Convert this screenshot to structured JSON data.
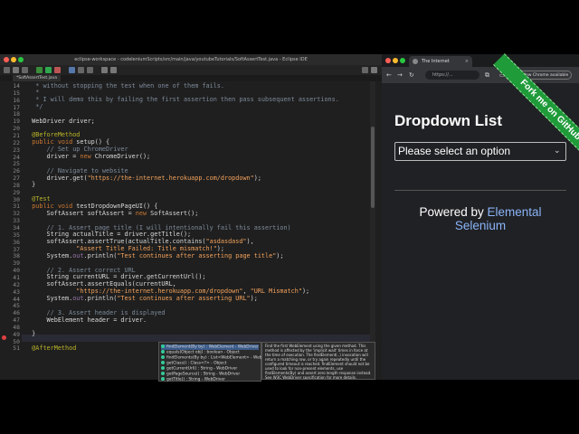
{
  "eclipse": {
    "window_title": "eclipse-workspace - codeleniumScripts/src/main/java/youtubeTutorials/SoftAssertTest.java - Eclipse IDE",
    "tab_label": "*SoftAssertTest.java",
    "lines": [
      {
        "no": "14",
        "text": "   * without stopping the test when one of them fails."
      },
      {
        "no": "15",
        "text": "   *"
      },
      {
        "no": "16",
        "text": "   * I will demo this by failing the first assertion then pass subsequent assertions."
      },
      {
        "no": "17",
        "text": "   */"
      },
      {
        "no": "18",
        "text": ""
      },
      {
        "no": "19",
        "text": "  WebDriver driver;"
      },
      {
        "no": "20",
        "text": ""
      },
      {
        "no": "21",
        "text": "  @BeforeMethod"
      },
      {
        "no": "22",
        "text": "  public void setup() {"
      },
      {
        "no": "23",
        "text": "      // Set up ChromeDriver"
      },
      {
        "no": "24",
        "text": "      driver = new ChromeDriver();"
      },
      {
        "no": "25",
        "text": ""
      },
      {
        "no": "26",
        "text": "      // Navigate to website"
      },
      {
        "no": "27",
        "text": "      driver.get(\"https://the-internet.herokuapp.com/dropdown\");"
      },
      {
        "no": "28",
        "text": "  }"
      },
      {
        "no": "29",
        "text": ""
      },
      {
        "no": "30",
        "text": "  @Test"
      },
      {
        "no": "31",
        "text": "  public void testDropdownPageUI() {"
      },
      {
        "no": "32",
        "text": "      SoftAssert softAssert = new SoftAssert();"
      },
      {
        "no": "33",
        "text": ""
      },
      {
        "no": "34",
        "text": "      // 1. Assert page title (I will intentionally fail this assertion)"
      },
      {
        "no": "35",
        "text": "      String actualTitle = driver.getTitle();"
      },
      {
        "no": "36",
        "text": "      softAssert.assertTrue(actualTitle.contains(\"asdasdasd\"),"
      },
      {
        "no": "37",
        "text": "              \"Assert Title Failed: Title mismatch!\");"
      },
      {
        "no": "38",
        "text": "      System.out.println(\"Test continues after asserting page title\");"
      },
      {
        "no": "39",
        "text": ""
      },
      {
        "no": "40",
        "text": "      // 2. Assert correct URL"
      },
      {
        "no": "41",
        "text": "      String currentURL = driver.getCurrentUrl();"
      },
      {
        "no": "42",
        "text": "      softAssert.assertEquals(currentURL,"
      },
      {
        "no": "43",
        "text": "              \"https://the-internet.herokuapp.com/dropdown\", \"URL Mismatch\");"
      },
      {
        "no": "44",
        "text": "      System.out.println(\"Test continues after asserting URL\");"
      },
      {
        "no": "45",
        "text": ""
      },
      {
        "no": "46",
        "text": "      // 3. Assert header is displayed"
      },
      {
        "no": "47",
        "text": "      WebElement header = driver."
      },
      {
        "no": "48",
        "text": ""
      },
      {
        "no": "49",
        "text": "  }"
      },
      {
        "no": "50",
        "text": ""
      },
      {
        "no": "51",
        "text": "  @AfterMethod"
      }
    ],
    "autocomplete": {
      "items": [
        "findElement(By by) : WebElement - WebDriver",
        "equals(Object obj) : boolean - Object",
        "findElements(By by) : List<WebElement> - WebDriver",
        "getClass() : Class<?> - Object",
        "getCurrentUrl() : String - WebDriver",
        "getPageSource() : String - WebDriver",
        "getTitle() : String - WebDriver"
      ],
      "doc": "Find the first WebElement using the given method. This method is affected by the 'implicit wait' times in force at the time of execution. The findElement(..) invocation will return a matching row, or try again repeatedly until the configured timeout is reached. findElement should not be used to look for non-present elements, use findElements(By) and assert zero length response instead. See W3C WebDriver specification for more details."
    }
  },
  "chrome": {
    "tab_title": "The Internet",
    "url": "https://...",
    "update_label": "New Chrome available",
    "page": {
      "heading": "Dropdown List",
      "select_value": "Please select an option",
      "powered_by": "Powered by",
      "powered_link": "Elemental Selenium",
      "ribbon": "Fork me on GitHub"
    }
  },
  "colors": {
    "editor_bg": "#1f1f1f",
    "keyword": "#cc7832",
    "string": "#f4a35c",
    "link": "#8ab4f8",
    "ribbon": "#1f9b3a"
  }
}
